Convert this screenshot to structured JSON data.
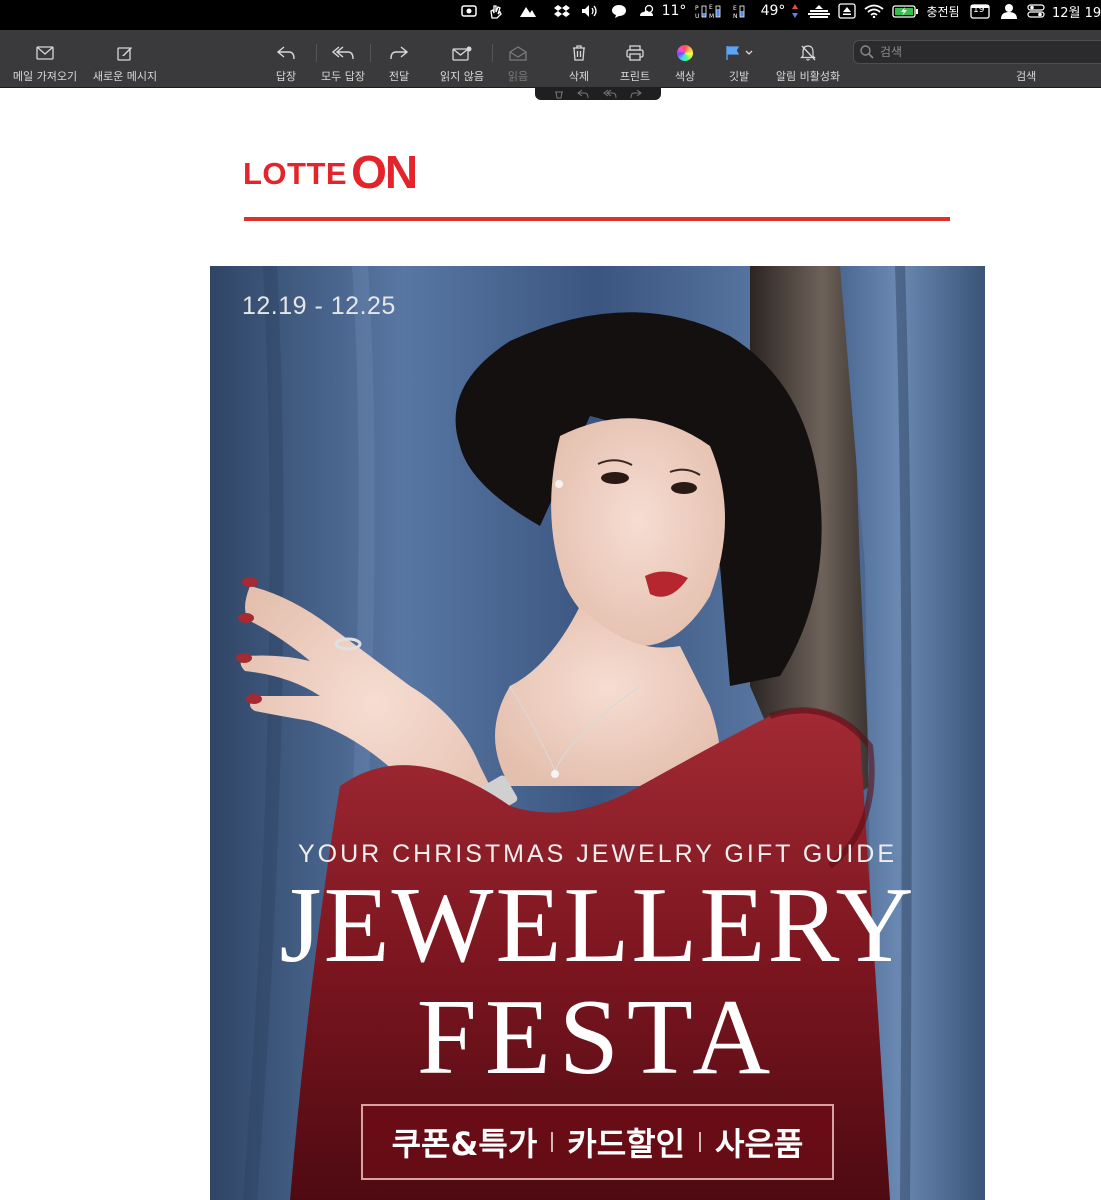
{
  "menubar": {
    "temperature": "11°",
    "cpu_temp": "49°",
    "charge_status": "충전됨",
    "calendar_day": "19",
    "clock": "12월 19"
  },
  "toolbar": {
    "get_mail": "메일 가져오기",
    "new_message": "새로운 메시지",
    "reply": "답장",
    "reply_all": "모두 답장",
    "forward": "전달",
    "mark_unread": "읽지 않음",
    "mark_read": "읽음",
    "delete": "삭제",
    "print": "프린트",
    "color": "색상",
    "flag": "깃발",
    "mute": "알림 비활성화",
    "search_placeholder": "검색",
    "search_label": "검색"
  },
  "email": {
    "logo_text_1": "LOTTE",
    "logo_text_2": "ON",
    "banner": {
      "date_range": "12.19 - 12.25",
      "subtitle": "YOUR CHRISTMAS JEWELRY GIFT GUIDE",
      "title_line1": "JEWELLERY",
      "title_line2": "FESTA",
      "tag_1": "쿠폰&특가",
      "tag_2": "카드할인",
      "tag_3": "사은품"
    }
  },
  "colors": {
    "brand_red": "#e3242b",
    "toolbar_bg": "#3a3a3c",
    "curtain_blue": "#3f5a82",
    "dress_red": "#7d1620"
  }
}
